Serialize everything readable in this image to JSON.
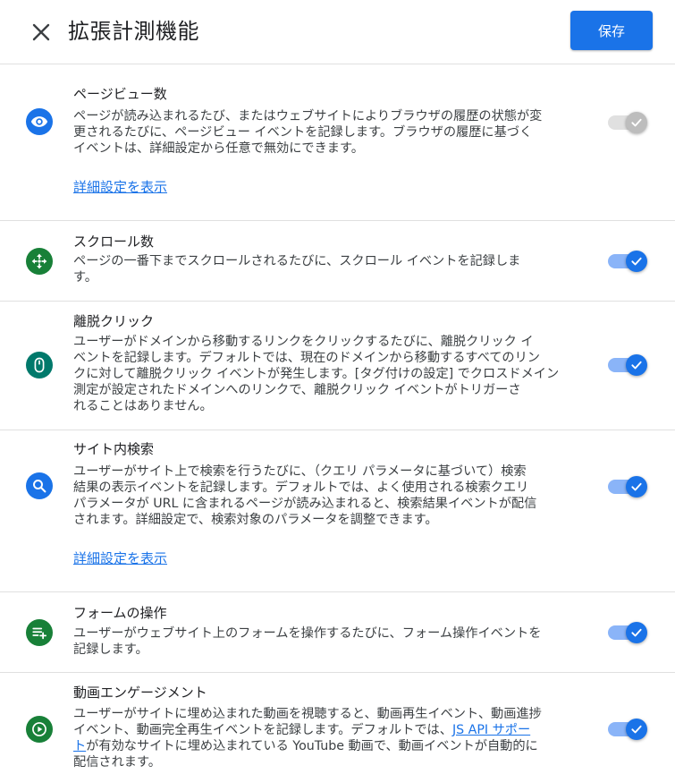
{
  "header": {
    "title": "拡張計測機能",
    "save_label": "保存"
  },
  "colors": {
    "primary": "#1a73e8",
    "toggle_track_on": "#8ab4f8",
    "toggle_disabled": "#bdbdbd",
    "icon_blue": "#1a73e8",
    "icon_green": "#188038",
    "icon_teal": "#00796b"
  },
  "items": [
    {
      "title": "ページビュー数",
      "description": "ページが読み込まれるたび、またはウェブサイトによりブラウザの履歴の状態が変\n更されるたびに、ページビュー イベントを記録します。ブラウザの履歴に基づく\nイベントは、詳細設定から任意で無効にできます。",
      "link": "詳細設定を表示",
      "icon": "eye-icon",
      "toggle": "on-disabled"
    },
    {
      "title": "スクロール数",
      "description": "ページの一番下までスクロールされるたびに、スクロール イベントを記録しま\nす。",
      "icon": "scroll-icon",
      "toggle": "on"
    },
    {
      "title": "離脱クリック",
      "description": "ユーザーがドメインから移動するリンクをクリックするたびに、離脱クリック イ\nベントを記録します。デフォルトでは、現在のドメインから移動するすべてのリン\nクに対して離脱クリック イベントが発生します。[タグ付けの設定] でクロスドメイン\n測定が設定されたドメインへのリンクで、離脱クリック イベントがトリガーさ\nれることはありません。",
      "icon": "mouse-icon",
      "toggle": "on"
    },
    {
      "title": "サイト内検索",
      "description": "ユーザーがサイト上で検索を行うたびに、（クエリ パラメータに基づいて）検索\n結果の表示イベントを記録します。デフォルトでは、よく使用される検索クエリ\nパラメータが URL に含まれるページが読み込まれると、検索結果イベントが配信\nされます。詳細設定で、検索対象のパラメータを調整できます。",
      "link": "詳細設定を表示",
      "icon": "search-icon",
      "toggle": "on"
    },
    {
      "title": "フォームの操作",
      "description": "ユーザーがウェブサイト上のフォームを操作するたびに、フォーム操作イベントを\n記録します。",
      "icon": "form-icon",
      "toggle": "on"
    },
    {
      "title": "動画エンゲージメント",
      "description_part1": "ユーザーがサイトに埋め込まれた動画を視聴すると、動画再生イベント、動画進捗\nイベント、動画完全再生イベントを記録します。デフォルトでは、",
      "description_link": "JS API サポー\nト",
      "description_part2": "が有効なサイトに埋め込まれている YouTube 動画で、動画イベントが自動的に\n配信されます。",
      "icon": "play-icon",
      "toggle": "on"
    }
  ]
}
